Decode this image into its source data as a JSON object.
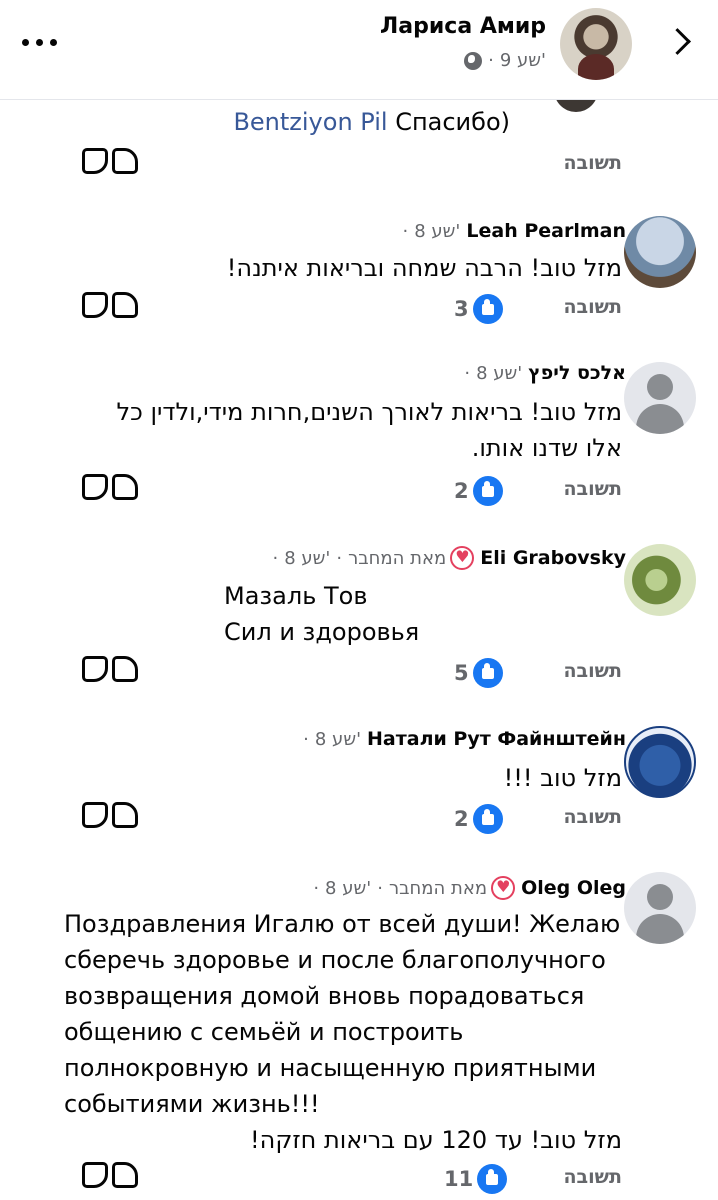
{
  "header": {
    "author": "Лариса Амир",
    "time": "9 שע'",
    "separator": "·"
  },
  "partial": {
    "mention": "Bentziyon Pil",
    "text": "Спасибо)",
    "reply_label": "תשובה"
  },
  "comments": [
    {
      "name": "Leah Pearlman",
      "time": "8 שע'",
      "lines": [
        "מזל טוב! הרבה שמחה ובריאות איתנה!"
      ],
      "reply_label": "תשובה",
      "likes": "3"
    },
    {
      "name": "אלכס ליפץ",
      "time": "8 שע'",
      "lines": [
        "מזל טוב! בריאות לאורך השנים,חרות מידי,ולדין כל",
        "אלו שדנו אותו."
      ],
      "reply_label": "תשובה",
      "likes": "2"
    },
    {
      "name": "Eli Grabovsky",
      "badge": "מאת המחבר",
      "time": "8 שע'",
      "lines": [
        "Мазаль Тов",
        "Сил и здоровья"
      ],
      "reply_label": "תשובה",
      "likes": "5"
    },
    {
      "name": "Натали Рут Файнштейн",
      "time": "8 שע'",
      "lines": [
        "מזל טוב !!!"
      ],
      "reply_label": "תשובה",
      "likes": "2"
    },
    {
      "name": "Oleg Oleg",
      "badge": "מאת המחבר",
      "time": "8 שע'",
      "lines": [
        "Поздравления Игалю от всей души! Желаю",
        "сберечь здоровье и после благополучного",
        "возвращения домой вновь порадоваться",
        "общению с семьёй и построить",
        "полнокровную и насыщенную приятными",
        "событиями жизнь!!!",
        "מזל טוב! עד 120 עם בריאות חזקה!"
      ],
      "reply_label": "תשובה",
      "likes": "11"
    }
  ],
  "colors": {
    "like_blue": "#1877f2",
    "mention_blue": "#385898",
    "meta_gray": "#65676b",
    "author_heart": "#e4405f"
  }
}
